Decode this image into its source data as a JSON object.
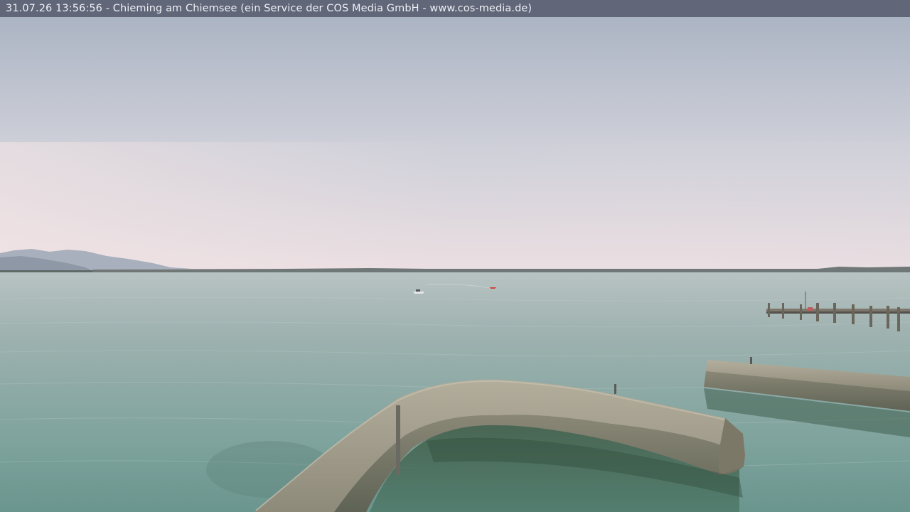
{
  "caption": {
    "text": "31.07.26 13:56:56 - Chieming am Chiemsee (ein Service der COS Media GmbH - www.cos-media.de)"
  },
  "colors": {
    "sky_top": "#a9b3c2",
    "sky_horizon": "#e9dfe2",
    "water_far": "#b2bfbd",
    "water_near": "#6e9a93",
    "wall_stone": "#9c9886",
    "caption_bar": "#565c6e"
  }
}
